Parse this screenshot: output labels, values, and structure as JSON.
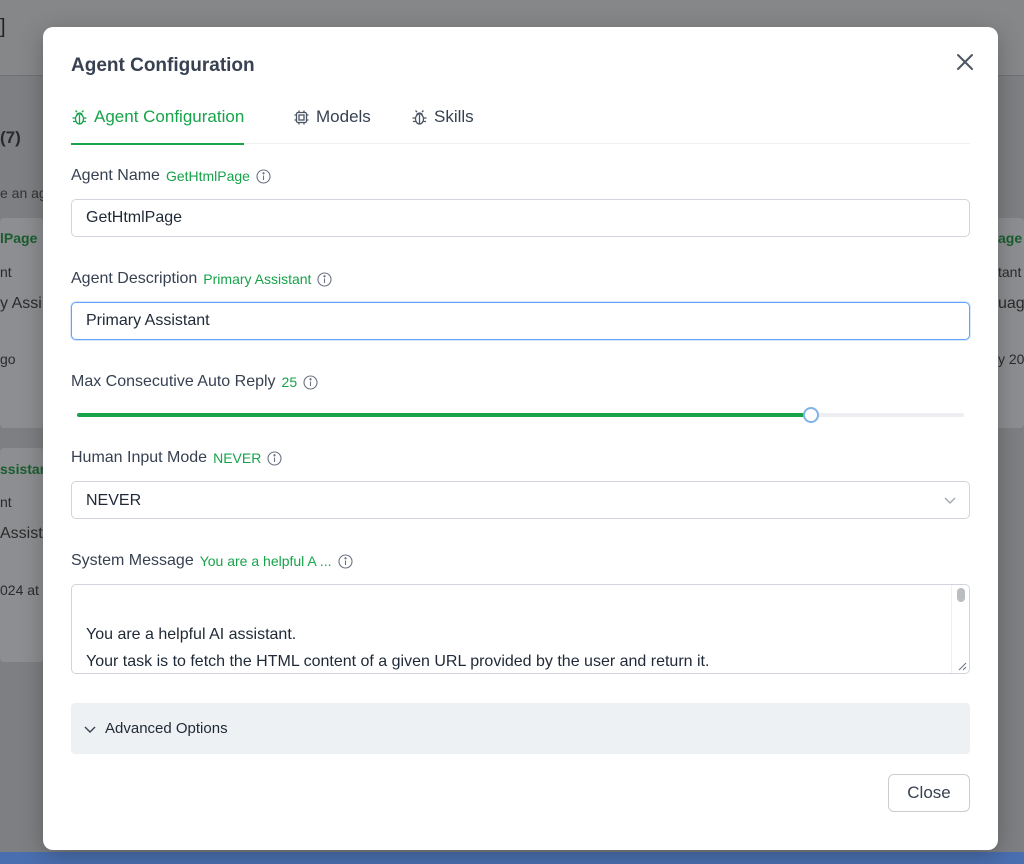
{
  "background": {
    "bracket": "]",
    "count": "(7)",
    "hint": "e an ag",
    "left_card_1": {
      "title": "lPage",
      "sub": "nt",
      "desc": "y Assi",
      "time": "go"
    },
    "left_card_2": {
      "title": "ssistar",
      "sub": "nt",
      "desc": "Assista",
      "time": "024 at"
    },
    "right_card": {
      "title": "age",
      "sub": "tant",
      "desc": "uag",
      "time": "y 20"
    }
  },
  "modal": {
    "title": "Agent Configuration",
    "tabs": [
      {
        "label": "Agent Configuration",
        "icon": "bug-icon",
        "active": true
      },
      {
        "label": "Models",
        "icon": "cpu-icon",
        "active": false
      },
      {
        "label": "Skills",
        "icon": "bug-icon",
        "active": false
      }
    ],
    "agent_name": {
      "label": "Agent Name",
      "hint": "GetHtmlPage",
      "value": "GetHtmlPage"
    },
    "agent_description": {
      "label": "Agent Description",
      "hint": "Primary Assistant",
      "value": "Primary Assistant"
    },
    "max_auto_reply": {
      "label": "Max Consecutive Auto Reply",
      "hint": "25",
      "value": 25,
      "fraction": 0.827
    },
    "human_input_mode": {
      "label": "Human Input Mode",
      "hint": "NEVER",
      "selected": "NEVER"
    },
    "system_message": {
      "label": "System Message",
      "hint": "You are a helpful A ...",
      "lines": [
        "You are a helpful AI assistant.",
        "Your task is to fetch the HTML content of a given URL provided by the user and return it."
      ]
    },
    "advanced_label": "Advanced Options",
    "close_label": "Close"
  },
  "colors": {
    "accent": "#16a34a",
    "focus": "#60a5fa",
    "panel": "#eef1f4"
  }
}
